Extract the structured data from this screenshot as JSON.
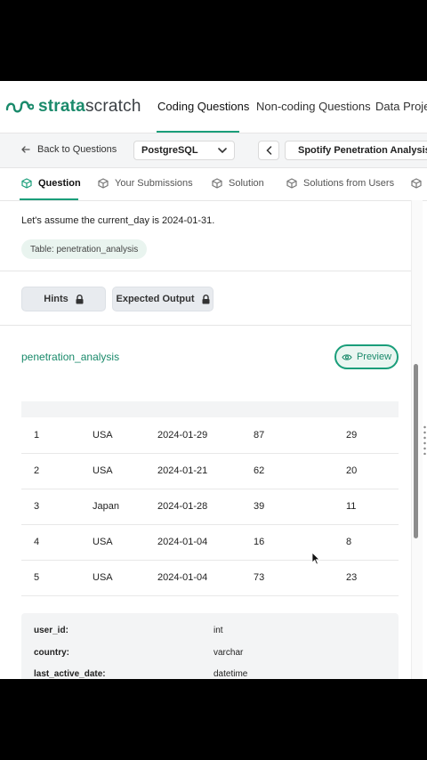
{
  "logo": {
    "part1": "strata",
    "part2": "scratch"
  },
  "nav": {
    "coding": "Coding Questions",
    "noncoding": "Non-coding Questions",
    "data_projects": "Data Projec"
  },
  "subbar": {
    "back": "Back to Questions",
    "dialect": "PostgreSQL",
    "question": "Spotify Penetration Analysis"
  },
  "tabs": {
    "question": "Question",
    "submissions": "Your Submissions",
    "solution": "Solution",
    "solutions_users": "Solutions from Users"
  },
  "content": {
    "assumption": "Let's assume the current_day is 2024-01-31.",
    "table_badge": "Table: penetration_analysis",
    "hints": "Hints",
    "expected_output": "Expected Output"
  },
  "dataset": {
    "name": "penetration_analysis",
    "preview_label": "Preview",
    "rows": [
      [
        "1",
        "USA",
        "2024-01-29",
        "87",
        "29"
      ],
      [
        "2",
        "USA",
        "2024-01-21",
        "62",
        "20"
      ],
      [
        "3",
        "Japan",
        "2024-01-28",
        "39",
        "11"
      ],
      [
        "4",
        "USA",
        "2024-01-04",
        "16",
        "8"
      ],
      [
        "5",
        "USA",
        "2024-01-04",
        "73",
        "23"
      ]
    ]
  },
  "schema": [
    {
      "key": "user_id:",
      "type": "int"
    },
    {
      "key": "country:",
      "type": "varchar"
    },
    {
      "key": "last_active_date:",
      "type": "datetime"
    }
  ],
  "colors": {
    "accent": "#1a9e7a",
    "accent_text": "#1a8a6b"
  },
  "icons": [
    "strata-logo-icon",
    "arrow-left-icon",
    "chevron-down-icon",
    "chevron-left-icon",
    "list-icon",
    "cube-icon",
    "lock-icon",
    "eye-icon",
    "cursor-icon"
  ]
}
